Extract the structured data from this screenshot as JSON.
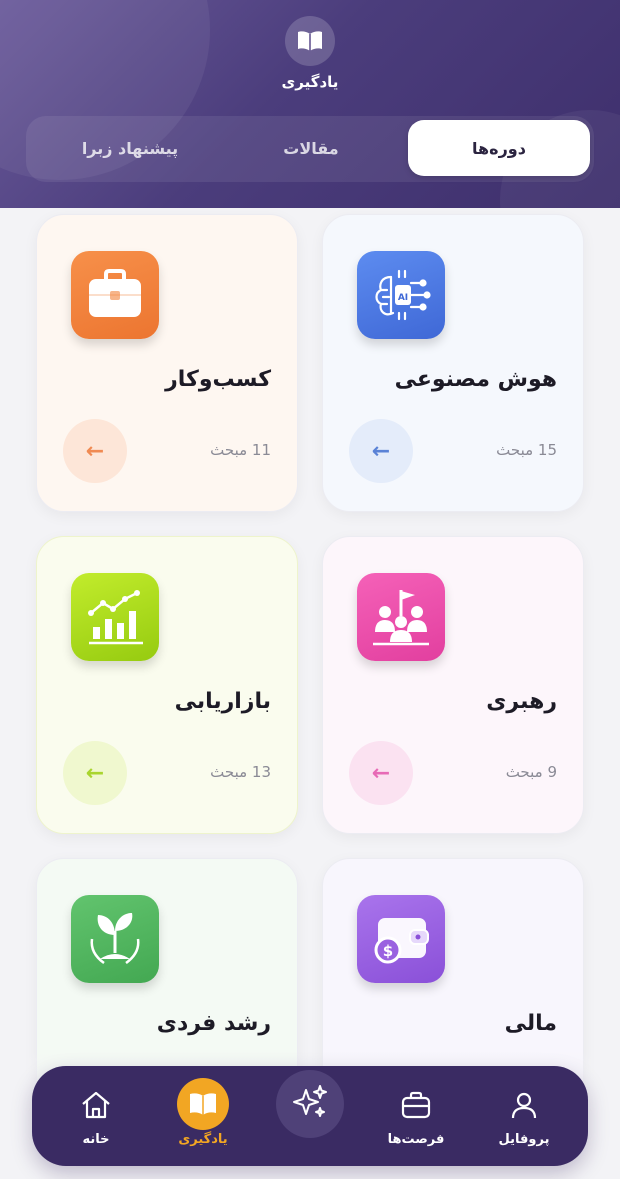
{
  "header": {
    "title": "یادگیری",
    "tabs": [
      {
        "label": "دوره‌ها",
        "active": true
      },
      {
        "label": "مقالات",
        "active": false
      },
      {
        "label": "پیشنهاد زبرا",
        "active": false
      }
    ]
  },
  "cards": [
    {
      "title": "هوش مصنوعی",
      "topics": "15 مبحث",
      "icon": "ai-chip-icon",
      "color": "#4f7be0",
      "arrow": "←"
    },
    {
      "title": "کسب‌وکار",
      "topics": "11 مبحث",
      "icon": "briefcase-icon",
      "color": "#f2843c",
      "arrow": "←"
    },
    {
      "title": "رهبری",
      "topics": "9 مبحث",
      "icon": "leadership-flag-icon",
      "color": "#ee4fae",
      "arrow": "←"
    },
    {
      "title": "بازاریابی",
      "topics": "13 مبحث",
      "icon": "growth-chart-icon",
      "color": "#a6d81a",
      "arrow": "←"
    },
    {
      "title": "مالی",
      "topics": "",
      "icon": "wallet-dollar-icon",
      "color": "#9a62e0",
      "arrow": ""
    },
    {
      "title": "رشد فردی",
      "topics": "",
      "icon": "plant-sprout-icon",
      "color": "#52b860",
      "arrow": ""
    }
  ],
  "nav": {
    "items": [
      {
        "label": "خانه",
        "icon": "home-icon"
      },
      {
        "label": "یادگیری",
        "icon": "book-icon",
        "active": true
      },
      {
        "label": "",
        "icon": "sparkles-icon"
      },
      {
        "label": "فرصت‌ها",
        "icon": "briefcase-icon"
      },
      {
        "label": "پروفایل",
        "icon": "user-icon"
      }
    ],
    "active_color": "#f2a623",
    "bg_color": "#3a2b63"
  }
}
